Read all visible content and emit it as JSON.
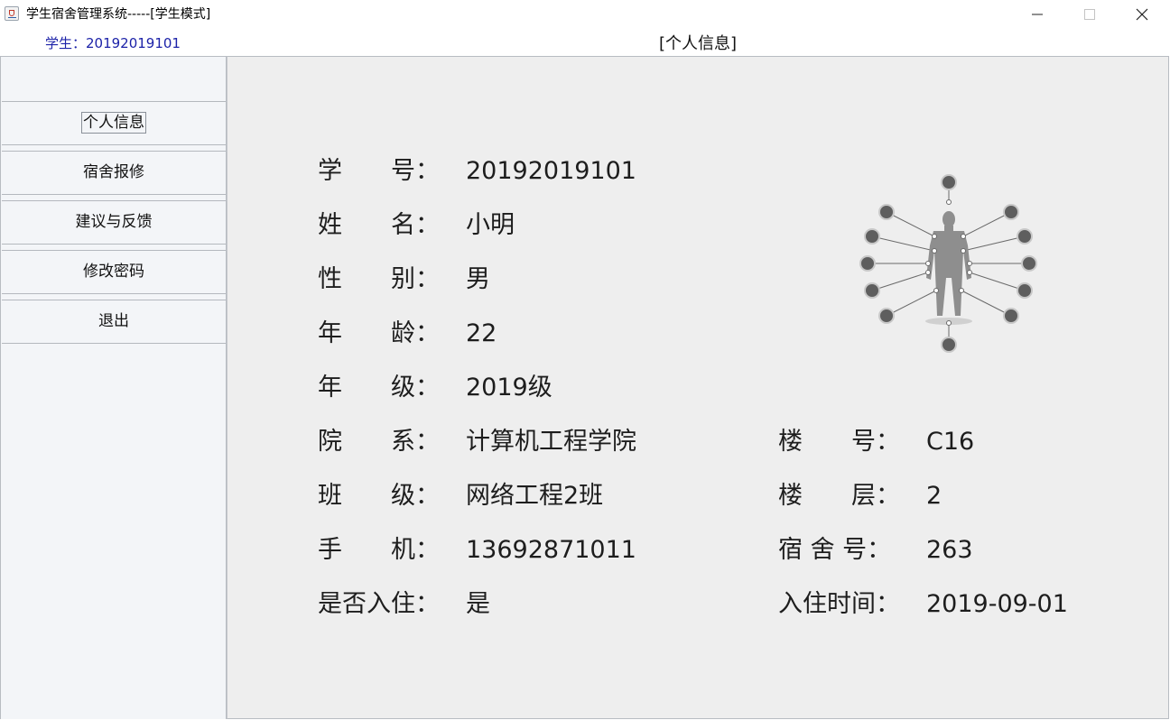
{
  "window": {
    "title": "学生宿舍管理系统-----[学生模式]",
    "controls": [
      "minimize-icon",
      "maximize-icon",
      "close-icon"
    ]
  },
  "header": {
    "student": "学生：20192019101",
    "panel_title": "[个人信息]"
  },
  "sidebar": {
    "items": [
      {
        "label": "个人信息",
        "active": true
      },
      {
        "label": "宿舍报修",
        "active": false
      },
      {
        "label": "建议与反馈",
        "active": false
      },
      {
        "label": "修改密码",
        "active": false
      },
      {
        "label": "退出",
        "active": false
      }
    ]
  },
  "profile": {
    "left": [
      {
        "label": "学　　号：",
        "value": "20192019101"
      },
      {
        "label": "姓　　名：",
        "value": "小明"
      },
      {
        "label": "性　　别：",
        "value": "男"
      },
      {
        "label": "年　　龄：",
        "value": "22"
      },
      {
        "label": "年　　级：",
        "value": "2019级"
      },
      {
        "label": "院　　系：",
        "value": "计算机工程学院"
      },
      {
        "label": "班　　级：",
        "value": "网络工程2班"
      },
      {
        "label": "手　　机：",
        "value": "13692871011"
      },
      {
        "label": "是否入住：",
        "value": "是"
      }
    ],
    "right": [
      {
        "label": "楼　　号：",
        "value": "C16"
      },
      {
        "label": "楼　　层：",
        "value": "2"
      },
      {
        "label": "宿 舍 号：",
        "value": "263"
      },
      {
        "label": "入住时间：",
        "value": "2019-09-01"
      }
    ],
    "avatar_icon": "user-network-icon"
  },
  "colors": {
    "student_text": "#1c22a8",
    "panel_bg": "#eeeeee",
    "sidebar_bg": "#f3f5f8"
  }
}
